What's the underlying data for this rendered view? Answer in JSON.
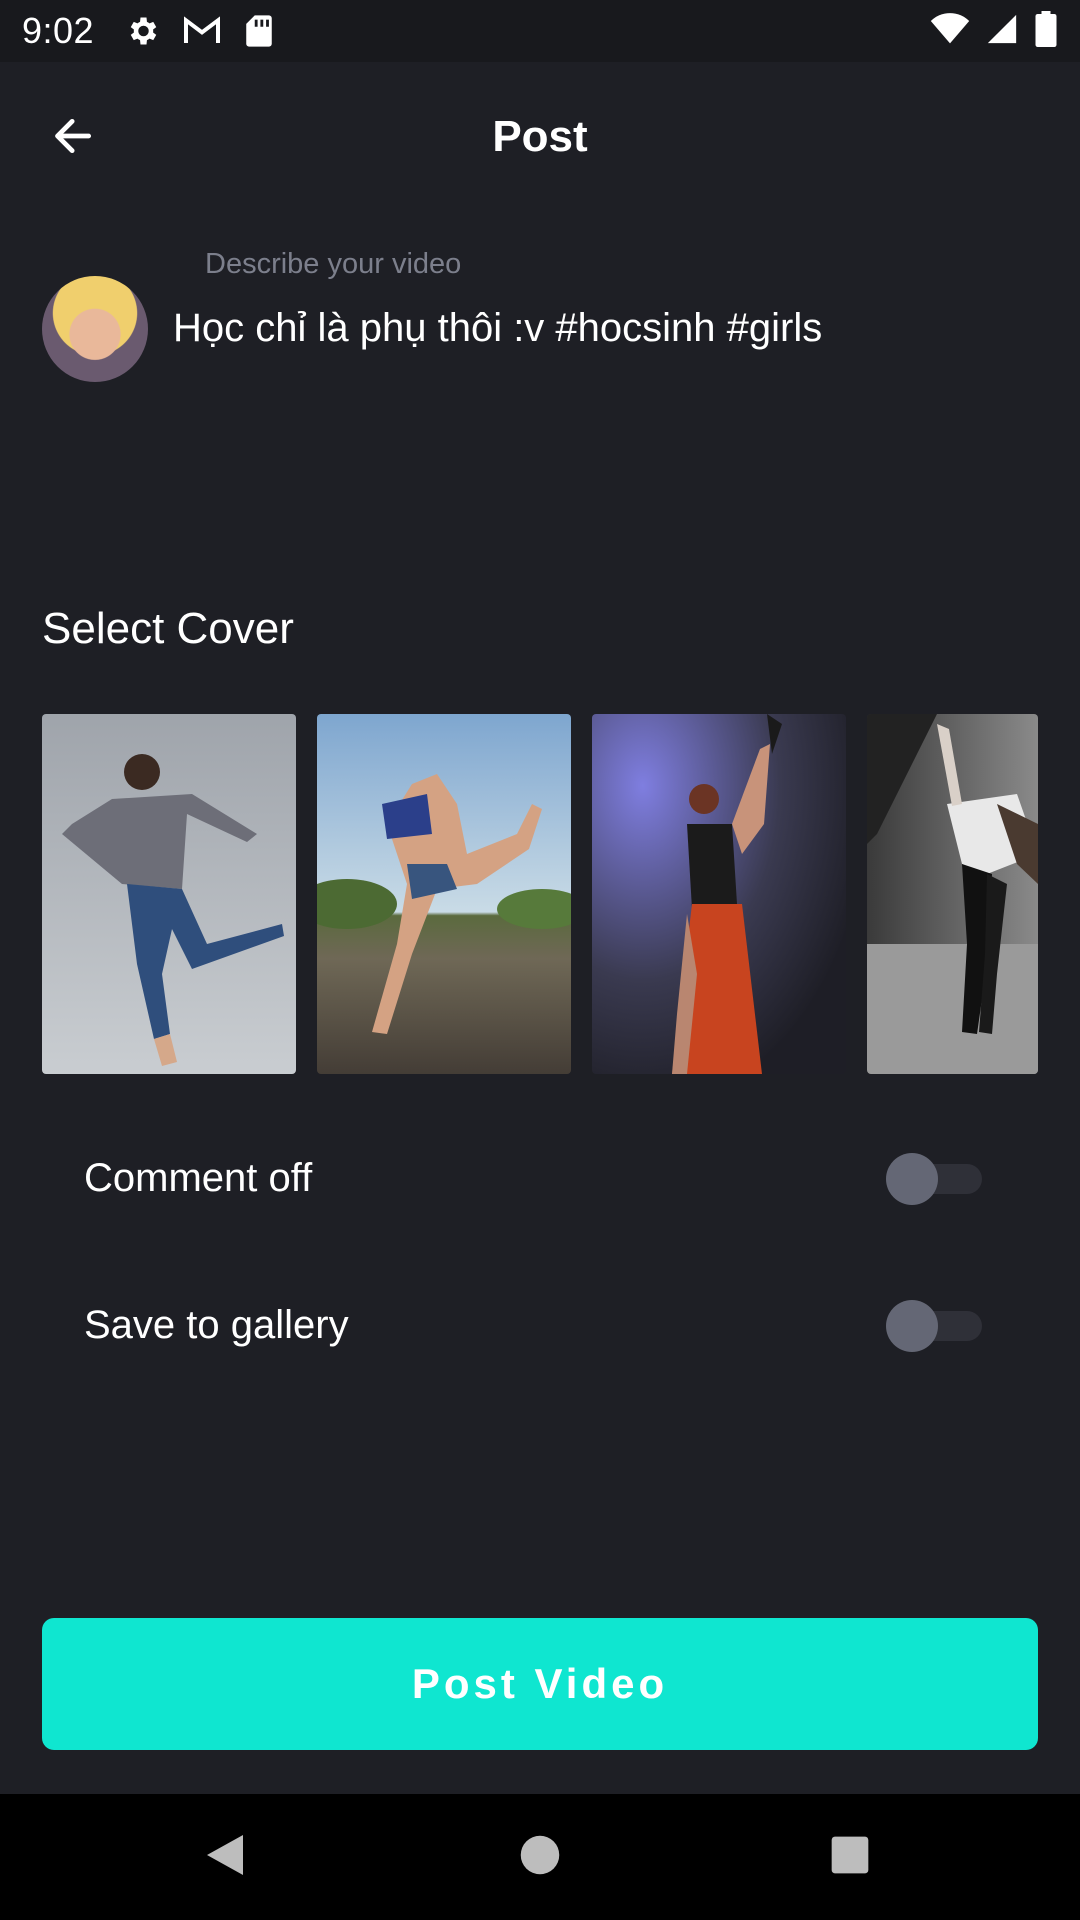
{
  "status_bar": {
    "time": "9:02",
    "icons_left": [
      "gear-icon",
      "gmail-icon",
      "sd-card-icon"
    ],
    "icons_right": [
      "wifi-icon",
      "signal-icon",
      "battery-icon"
    ]
  },
  "header": {
    "title": "Post",
    "back_icon": "arrow-left-icon"
  },
  "description": {
    "hint": "Describe your video",
    "value": "Học chỉ là phụ thôi :v #hocsinh #girls"
  },
  "cover": {
    "title": "Select Cover",
    "thumbnails": [
      "dancer-man-jeans",
      "dancer-girl-road",
      "dancer-woman-red-skirt",
      "ballerina-bw"
    ]
  },
  "toggles": {
    "comment_off": {
      "label": "Comment off",
      "on": false
    },
    "save_gallery": {
      "label": "Save to gallery",
      "on": false
    }
  },
  "actions": {
    "post_label": "Post Video"
  },
  "colors": {
    "background": "#1e1f25",
    "accent": "#0fe6d0",
    "hint": "#7c7f8c",
    "switch_thumb": "#646775"
  },
  "nav": [
    "back-triangle-icon",
    "home-circle-icon",
    "recents-square-icon"
  ]
}
